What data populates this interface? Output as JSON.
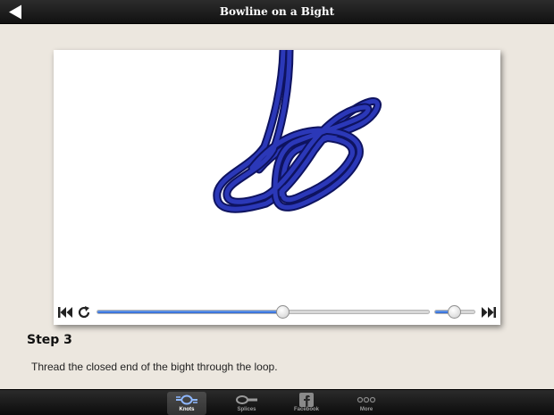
{
  "header": {
    "title": "Bowline on a Bight"
  },
  "player": {
    "progress": 0.56,
    "speed_level": 0.5
  },
  "step": {
    "heading": "Step 3",
    "text": "Thread the closed end of the bight through the loop."
  },
  "tabs": [
    {
      "label": "Knots",
      "icon": "knots-icon",
      "active": true
    },
    {
      "label": "Splices",
      "icon": "splices-icon",
      "active": false
    },
    {
      "label": "Facebook",
      "icon": "facebook-icon",
      "active": false
    },
    {
      "label": "More",
      "icon": "more-icon",
      "active": false
    }
  ],
  "colors": {
    "rope": "#1a2280",
    "accent": "#2a64d2",
    "background": "#ece7df"
  }
}
